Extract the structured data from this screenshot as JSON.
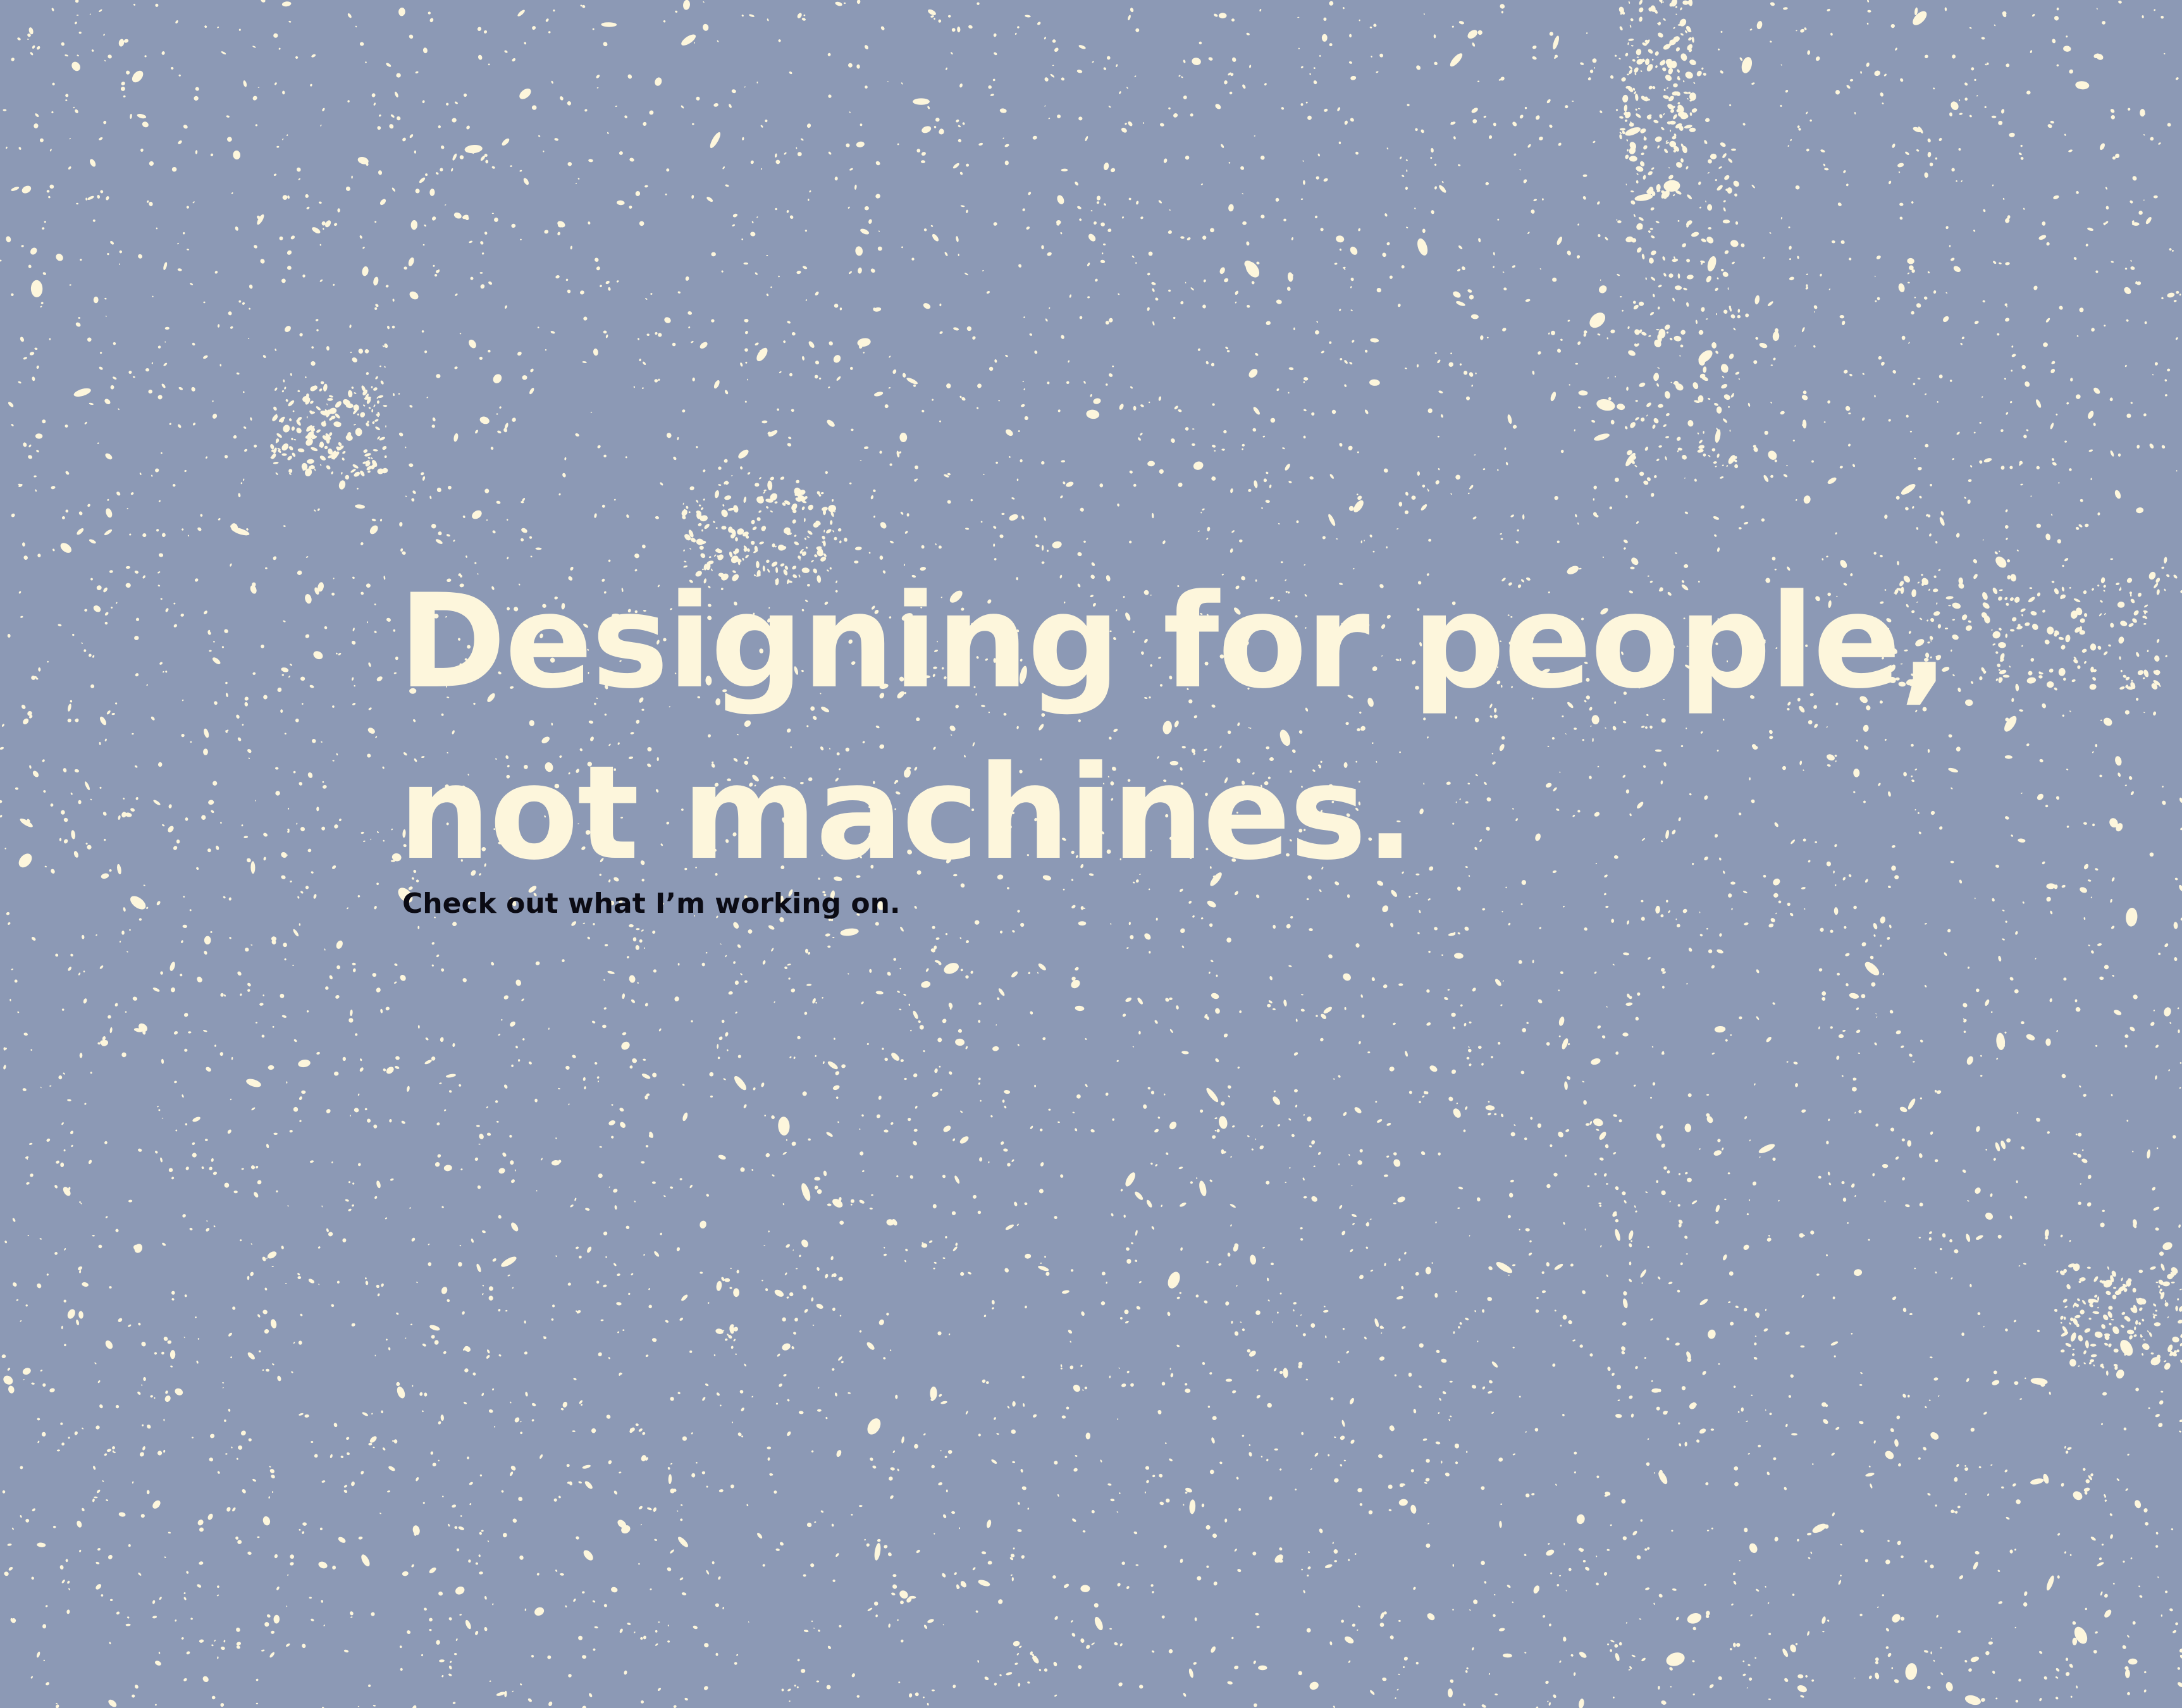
{
  "colors": {
    "background": "#8c99b5",
    "speckle": "#fdf6dc",
    "headline_text": "#fdf6dc",
    "subtitle_text": "#0b0b14"
  },
  "hero": {
    "headline_line1": "Designing for people,",
    "headline_line2": "not machines.",
    "subtitle": "Check out what I’m working on."
  }
}
